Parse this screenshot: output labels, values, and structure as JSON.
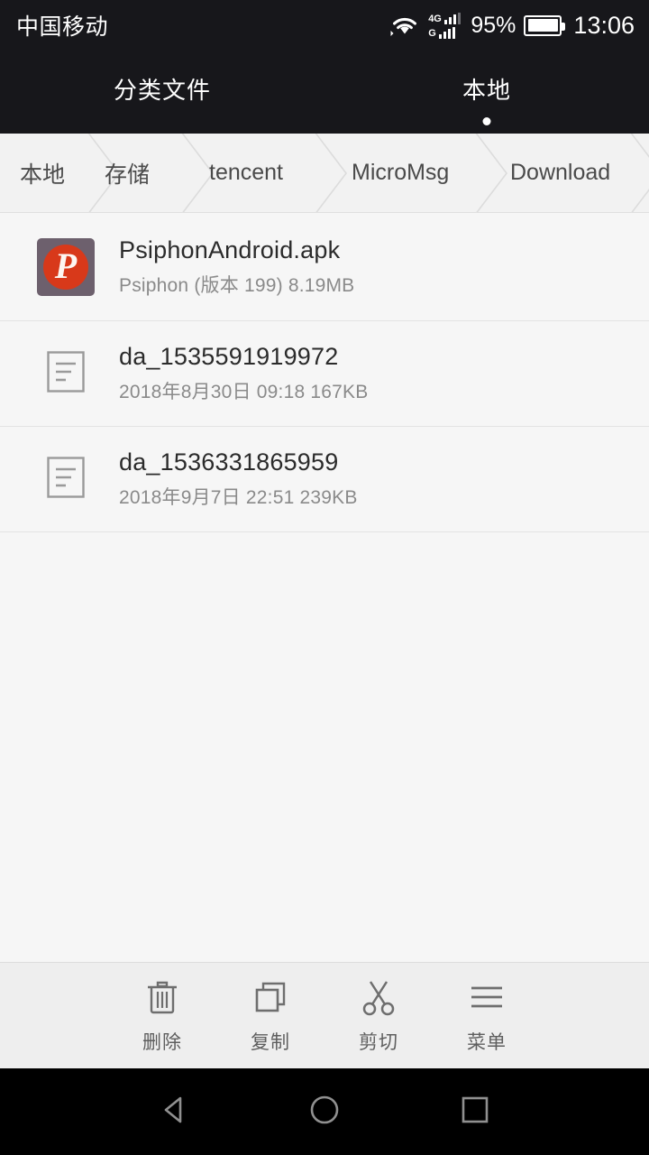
{
  "status_bar": {
    "carrier": "中国移动",
    "wifi_icon": "wifi-icon",
    "sim1_network": "4G",
    "sim2_network": "G",
    "sim1_bars": 3,
    "sim2_bars": 3,
    "battery_percent": "95%",
    "battery_level": 95,
    "clock": "13:06"
  },
  "tabs": [
    {
      "label": "分类文件",
      "active": false
    },
    {
      "label": "本地",
      "active": true
    }
  ],
  "breadcrumb": {
    "items": [
      {
        "label": "本地"
      },
      {
        "label": "存储"
      },
      {
        "label": "tencent"
      },
      {
        "label": "MicroMsg"
      },
      {
        "label": "Download"
      }
    ]
  },
  "files": [
    {
      "name": "PsiphonAndroid.apk",
      "meta": "Psiphon (版本 199) 8.19MB",
      "icon": "psiphon-app-icon",
      "icon_letter": "P",
      "icon_bg": "#6d606d",
      "icon_circle": "#d8391a"
    },
    {
      "name": "da_1535591919972",
      "meta": "2018年8月30日 09:18 167KB",
      "icon": "document-icon"
    },
    {
      "name": "da_1536331865959",
      "meta": "2018年9月7日 22:51 239KB",
      "icon": "document-icon"
    }
  ],
  "toolbar": [
    {
      "label": "删除",
      "icon": "trash-icon"
    },
    {
      "label": "复制",
      "icon": "copy-icon"
    },
    {
      "label": "剪切",
      "icon": "scissors-icon"
    },
    {
      "label": "菜单",
      "icon": "menu-icon"
    }
  ],
  "navigation": [
    {
      "icon": "back-icon"
    },
    {
      "icon": "home-icon"
    },
    {
      "icon": "recents-icon"
    }
  ],
  "colors": {
    "status_bg": "#17171b",
    "crumb_bg": "#f2f2f2",
    "list_bg": "#f6f6f6",
    "toolbar_bg": "#eeeeee",
    "nav_bg": "#000000",
    "text_primary": "#2b2b2b",
    "text_secondary": "#8a8a8a"
  }
}
